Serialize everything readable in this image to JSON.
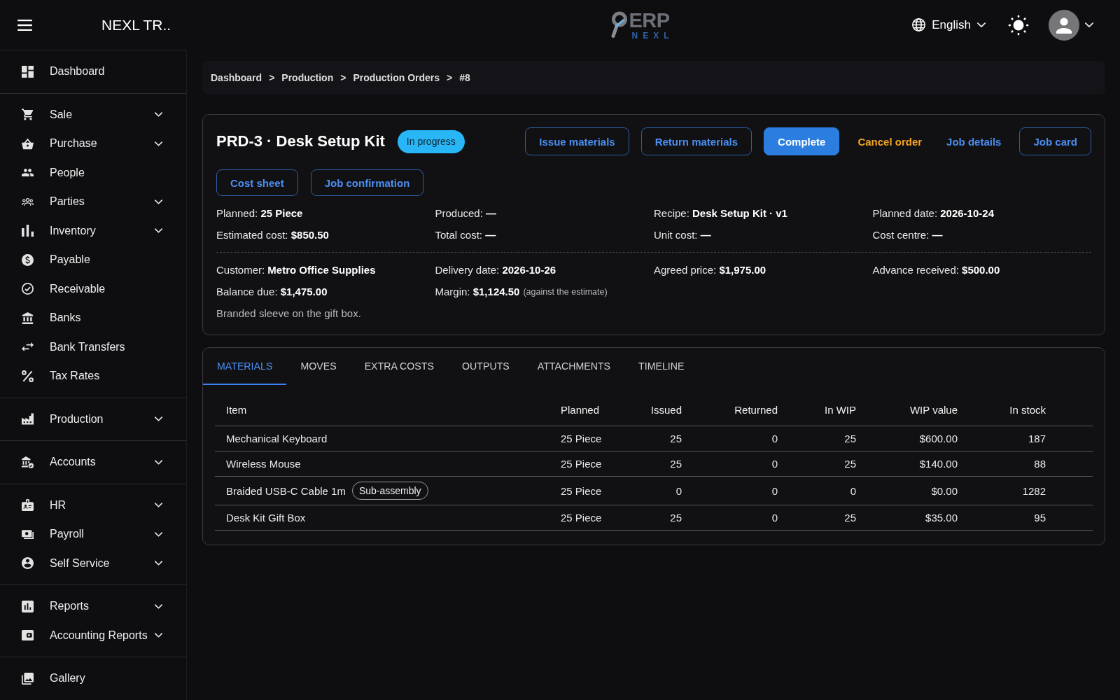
{
  "header": {
    "app_title": "NEXL TR..",
    "logo": {
      "text": "ERP",
      "subtext": "NEXL"
    },
    "language": "English"
  },
  "sidebar": {
    "sections": [
      {
        "items": [
          {
            "label": "Dashboard",
            "has_submenu": false
          }
        ]
      },
      {
        "items": [
          {
            "label": "Sale",
            "has_submenu": true
          },
          {
            "label": "Purchase",
            "has_submenu": true
          },
          {
            "label": "People",
            "has_submenu": false
          },
          {
            "label": "Parties",
            "has_submenu": true
          },
          {
            "label": "Inventory",
            "has_submenu": true
          },
          {
            "label": "Payable",
            "has_submenu": false
          },
          {
            "label": "Receivable",
            "has_submenu": false
          },
          {
            "label": "Banks",
            "has_submenu": false
          },
          {
            "label": "Bank Transfers",
            "has_submenu": false
          },
          {
            "label": "Tax Rates",
            "has_submenu": false
          }
        ]
      },
      {
        "items": [
          {
            "label": "Production",
            "has_submenu": true
          }
        ]
      },
      {
        "items": [
          {
            "label": "Accounts",
            "has_submenu": true
          }
        ]
      },
      {
        "items": [
          {
            "label": "HR",
            "has_submenu": true
          },
          {
            "label": "Payroll",
            "has_submenu": true
          },
          {
            "label": "Self Service",
            "has_submenu": true
          }
        ]
      },
      {
        "items": [
          {
            "label": "Reports",
            "has_submenu": true
          },
          {
            "label": "Accounting Reports",
            "has_submenu": true
          }
        ]
      },
      {
        "items": [
          {
            "label": "Gallery",
            "has_submenu": false
          }
        ]
      }
    ]
  },
  "breadcrumb": {
    "separator": ">",
    "items": [
      "Dashboard",
      "Production",
      "Production Orders",
      "#8"
    ]
  },
  "order": {
    "title": "PRD-3 · Desk Setup Kit",
    "status": "In progress",
    "actions": [
      {
        "label": "Issue materials",
        "kind": "outlined"
      },
      {
        "label": "Return materials",
        "kind": "outlined"
      },
      {
        "label": "Complete",
        "kind": "contained"
      },
      {
        "label": "Cancel order",
        "kind": "text_warning"
      },
      {
        "label": "Job details",
        "kind": "text"
      },
      {
        "label": "Job card",
        "kind": "outlined"
      }
    ],
    "secondary_actions": [
      {
        "label": "Cost sheet",
        "kind": "outlined"
      },
      {
        "label": "Job confirmation",
        "kind": "outlined"
      }
    ],
    "detail_groups": [
      {
        "fields": [
          {
            "text": "Planned: **25 Piece**"
          },
          {
            "text": "Produced: **—**"
          },
          {
            "text": "Recipe: **Desk Setup Kit · v1**"
          },
          {
            "text": "Planned date: **2026-10-24**"
          },
          {
            "text": "Estimated cost: **$850.50**"
          },
          {
            "text": "Total cost: **—**"
          },
          {
            "text": "Unit cost: **—**"
          },
          {
            "text": "Cost centre: **—**"
          }
        ]
      },
      {
        "fields": [
          {
            "text": "Customer: **Metro Office Supplies**"
          },
          {
            "text": "Delivery date: **2026-10-26**"
          },
          {
            "text": "Agreed price: **$1,975.00**"
          },
          {
            "text": "Advance received: **$500.00**"
          },
          {
            "text": "Balance due: **$1,475.00**"
          },
          {
            "text": "Margin: **$1,124.50**",
            "note": "(against the estimate)"
          }
        ]
      }
    ],
    "notes": "Branded sleeve on the gift box."
  },
  "tabs": [
    {
      "label": "MATERIALS",
      "selected": true
    },
    {
      "label": "MOVES",
      "selected": false
    },
    {
      "label": "EXTRA COSTS",
      "selected": false
    },
    {
      "label": "OUTPUTS",
      "selected": false
    },
    {
      "label": "ATTACHMENTS",
      "selected": false
    },
    {
      "label": "TIMELINE",
      "selected": false
    }
  ],
  "materials_table": {
    "columns": [
      "Item",
      "Planned",
      "Issued",
      "Returned",
      "In WIP",
      "WIP value",
      "In stock"
    ],
    "rows": [
      {
        "cells": [
          "Mechanical Keyboard",
          "25 Piece",
          "25",
          "0",
          "25",
          "$600.00",
          "187"
        ]
      },
      {
        "cells": [
          "Wireless Mouse",
          "25 Piece",
          "25",
          "0",
          "25",
          "$140.00",
          "88"
        ]
      },
      {
        "cells": [
          "Braided USB-C Cable 1m",
          "25 Piece",
          "0",
          "0",
          "0",
          "$0.00",
          "1282"
        ],
        "tag": "Sub-assembly"
      },
      {
        "cells": [
          "Desk Kit Gift Box",
          "25 Piece",
          "25",
          "0",
          "25",
          "$35.00",
          "95"
        ]
      }
    ]
  }
}
